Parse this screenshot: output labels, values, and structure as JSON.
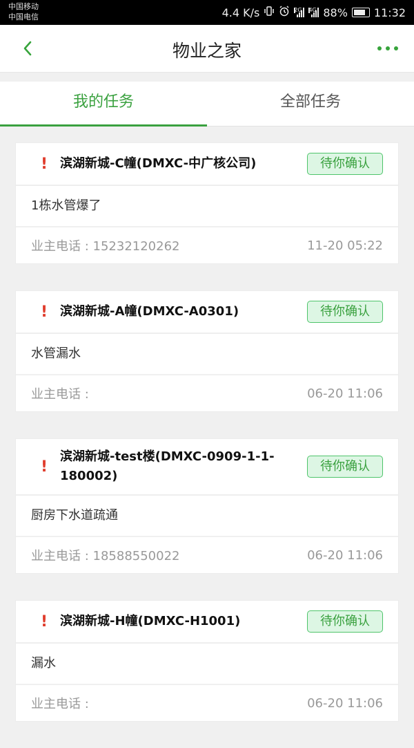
{
  "statusbar": {
    "carrier1": "中国移动",
    "carrier2": "中国电信",
    "speed": "4.4 K/s",
    "net1": "2G",
    "net2": "4G",
    "battery_pct": "88%",
    "time": "11:32"
  },
  "navbar": {
    "title": "物业之家"
  },
  "tabs": [
    {
      "label": "我的任务",
      "active": true
    },
    {
      "label": "全部任务",
      "active": false
    }
  ],
  "tasks": [
    {
      "title": "滨湖新城-C幢(DMXC-中广核公司)",
      "status": "待你确认",
      "description": "1栋水管爆了",
      "phone_label": "业主电话 : 15232120262",
      "time": "11-20 05:22"
    },
    {
      "title": "滨湖新城-A幢(DMXC-A0301)",
      "status": "待你确认",
      "description": "水管漏水",
      "phone_label": "业主电话 :",
      "time": "06-20 11:06"
    },
    {
      "title": "滨湖新城-test楼(DMXC-0909-1-1-180002)",
      "status": "待你确认",
      "description": "厨房下水道疏通",
      "phone_label": "业主电话 : 18588550022",
      "time": "06-20 11:06"
    },
    {
      "title": "滨湖新城-H幢(DMXC-H1001)",
      "status": "待你确认",
      "description": "漏水",
      "phone_label": "业主电话 :",
      "time": "06-20 11:06"
    }
  ],
  "colors": {
    "accent": "#3aa13f",
    "alert": "#e03d2d",
    "badge_bg": "#ddf6e4"
  }
}
